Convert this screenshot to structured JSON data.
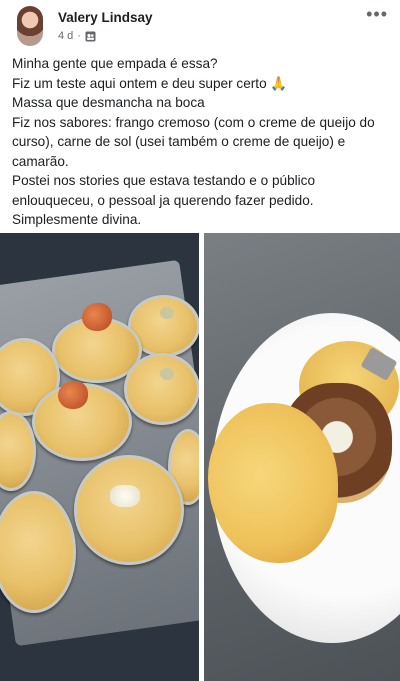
{
  "post": {
    "author": "Valery Lindsay",
    "time": "4 d",
    "separator": "·",
    "more_icon": "more-options-icon",
    "audience_icon": "friends-icon",
    "lines": [
      "Minha gente que empada é essa?",
      "Fiz um teste aqui ontem e deu super certo 🙏",
      "Massa que desmancha na boca",
      "Fiz nos sabores: frango cremoso (com o creme de queijo do curso), carne de sol (usei também o creme de queijo) e camarão.",
      "Postei nos stories que estava testando e o público enlouqueceu, o pessoal ja querendo fazer pedido.",
      "Simplesmente divina."
    ]
  },
  "photos": [
    {
      "description_icon": "photo-tray-of-empadas"
    },
    {
      "description_icon": "photo-cut-empada-on-plate"
    }
  ]
}
